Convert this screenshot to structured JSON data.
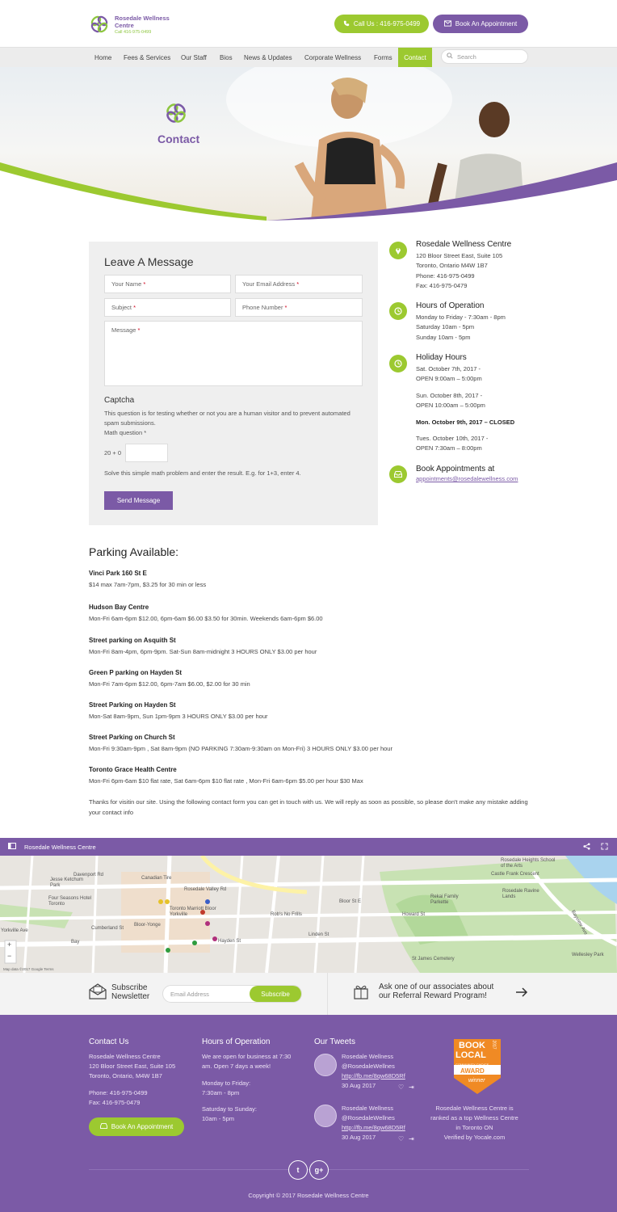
{
  "header": {
    "logo_name": "Rosedale Wellness Centre",
    "logo_phone": "Call 416-975-0499",
    "call_label": "Call Us : 416-975-0499",
    "book_label": "Book An Appointment"
  },
  "nav": {
    "items": [
      "Home",
      "Fees & Services",
      "Our Staff",
      "Bios",
      "News & Updates",
      "Corporate Wellness",
      "Forms",
      "Contact"
    ],
    "search_placeholder": "Search"
  },
  "hero": {
    "title": "Contact"
  },
  "form": {
    "title": "Leave A Message",
    "name_ph": "Your Name",
    "email_ph": "Your Email Address",
    "subject_ph": "Subject",
    "phone_ph": "Phone Number",
    "message_ph": "Message",
    "req": "*",
    "captcha_title": "Captcha",
    "captcha_desc": "This question is for testing whether or not you are a human visitor and to prevent automated spam submissions.",
    "math_label": "Math question *",
    "math_q": "20 + 0",
    "math_help": "Solve this simple math problem and enter the result. E.g. for 1+3, enter 4.",
    "send_label": "Send Message"
  },
  "info": {
    "centre_title": "Rosedale Wellness Centre",
    "centre_lines": [
      "120 Bloor Street East, Suite 105",
      "Toronto, Ontario M4W 1B7",
      "Phone: 416-975-0499",
      "Fax: 416-975-0479"
    ],
    "hours_title": "Hours of Operation",
    "hours_lines": [
      "Monday to Friday - 7:30am - 8pm",
      "Saturday 10am - 5pm",
      "Sunday 10am - 5pm"
    ],
    "holiday_title": "Holiday Hours",
    "holiday": [
      [
        "Sat. October 7th, 2017 -",
        "OPEN 9:00am – 5:00pm"
      ],
      [
        "Sun. October 8th, 2017 -",
        "OPEN 10:00am – 5:00pm"
      ],
      [
        "Mon. October 9th, 2017 – CLOSED"
      ],
      [
        "Tues. October 10th, 2017 -",
        "OPEN 7:30am – 8:00pm"
      ]
    ],
    "book_title": "Book Appointments at",
    "book_email": "appointments@rosedalewellness.com"
  },
  "parking": {
    "title": "Parking Available:",
    "items": [
      {
        "name": "Vinci Park 160 St E",
        "text": "$14 max 7am-7pm, $3.25 for 30 min or less"
      },
      {
        "name": "Hudson Bay Centre",
        "text": "Mon-Fri 6am-6pm $12.00, 6pm-6am $6.00 $3.50 for 30min. Weekends 6am-6pm $6.00"
      },
      {
        "name": "Street parking on Asquith St",
        "text": "Mon-Fri 8am-4pm, 6pm-9pm. Sat-Sun 8am-midnight 3 HOURS ONLY  $3.00 per hour"
      },
      {
        "name": "Green P parking on Hayden St",
        "text": "Mon-Fri 7am-6pm $12.00, 6pm-7am $6.00, $2.00 for 30 min"
      },
      {
        "name": "Street Parking on Hayden St",
        "text": "Mon-Sat 8am-9pm, Sun 1pm-9pm 3 HOURS ONLY $3.00 per hour"
      },
      {
        "name": "Street Parking on Church St",
        "text": "Mon-Fri 9:30am-9pm , Sat 8am-9pm (NO PARKING 7:30am-9:30am on Mon-Fri) 3 HOURS ONLY $3.00 per hour"
      },
      {
        "name": "Toronto Grace Health Centre",
        "text": "Mon-Fri 6pm-6am $10 flat rate, Sat 6am-6pm $10 flat rate , Mon-Fri 6am-6pm $5.00 per hour $30 Max"
      }
    ],
    "closing": "Thanks for visitin our site. Using the following contact form you can get in touch with us. We will reply as soon as possible, so please don't make any mistake adding your contact info"
  },
  "map": {
    "bar_title": "Rosedale Wellness Centre",
    "labels": [
      "Canadian Tire",
      "Rosedale Valley Rd",
      "Rosedale Heights School of the Arts",
      "Castle Frank Crescent",
      "Jesse Ketchum Park",
      "Davenport Rd",
      "Yorkville Ave",
      "Four Seasons Hotel Toronto",
      "Cumberland St",
      "Bloor-Yonge",
      "Toronto Marriott Bloor Yorkville",
      "Bloor St E",
      "Rob's No Frills",
      "Howard St",
      "Rekai Family Parkette",
      "Rosedale Ravine Lands",
      "Bayview Ave",
      "Linden St",
      "Hayden St",
      "St James Cemetery",
      "Wellesley Park",
      "Bay"
    ],
    "footer": "Map data ©2017 Google   Terms"
  },
  "subscribe": {
    "title_line1": "Subscribe",
    "title_line2": "Newsletter",
    "email_ph": "Email Address",
    "btn": "Subscribe",
    "refer_line1": "Ask one of our associates about",
    "refer_line2": "our Referral Reward Program!"
  },
  "footer": {
    "contact_title": "Contact Us",
    "contact_lines": [
      "Rosedale Wellness Centre",
      "120 Bloor Street East, Suite 105",
      "Toronto, Ontario, M4W 1B7"
    ],
    "contact_phone": "Phone: 416-975-0499",
    "contact_fax": "Fax: 416-975-0479",
    "book_btn": "Book An Appointment",
    "hours_title": "Hours of Operation",
    "hours_lines": [
      "We are open for business at 7:30",
      "am. Open 7 days a week!"
    ],
    "hours_weekday": [
      "Monday to Friday:",
      "7:30am - 8pm"
    ],
    "hours_weekend": [
      "Saturday to Sunday:",
      "10am - 5pm"
    ],
    "tweets_title": "Our Tweets",
    "tweets": [
      {
        "name": "Rosedale Wellness",
        "handle": "@RosedaleWellnes",
        "link": "http://fb.me/8qw68D5Rf",
        "date": "30 Aug 2017"
      },
      {
        "name": "Rosedale Wellness",
        "handle": "@RosedaleWellnes",
        "link": "http://fb.me/8qw68D5Rf",
        "date": "30 Aug 2017"
      }
    ],
    "badge_lines": [
      "BOOK",
      "LOCAL",
      "COMMUNITY CHOICE",
      "AWARD",
      "winner",
      "2017"
    ],
    "award_text": [
      "Rosedale Wellness Centre is",
      "ranked as a top Wellness Centre",
      "in Toronto ON",
      "Verified by Yocale.com"
    ],
    "twitter": "t",
    "gplus": "g+",
    "copyright": "Copyright © 2017 Rosedale Wellness Centre"
  },
  "colors": {
    "purple": "#7b5aa6",
    "green": "#9cc930"
  }
}
